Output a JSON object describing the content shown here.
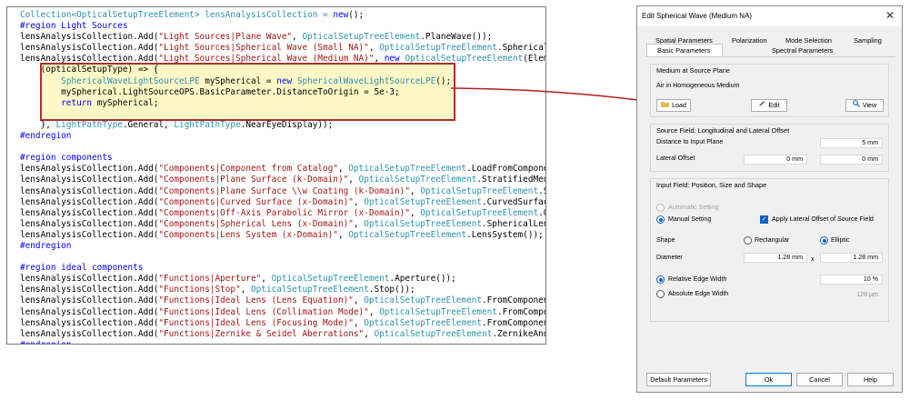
{
  "code": {
    "lines": [
      [
        {
          "t": "Collection<",
          "c": "ty"
        },
        {
          "t": "OpticalSetupTreeElement",
          "c": "ty"
        },
        {
          "t": "> lensAnalysisCollection = ",
          "c": "ty"
        },
        {
          "t": "new",
          "c": "kw"
        },
        {
          "t": "();",
          "c": ""
        }
      ],
      [
        {
          "t": "#region",
          "c": "kw"
        },
        {
          "t": " Light Sources",
          "c": "kw"
        }
      ],
      [
        {
          "t": "lensAnalysisCollection.Add(",
          "c": ""
        },
        {
          "t": "\"Light Sources|Plane Wave\"",
          "c": "st"
        },
        {
          "t": ", ",
          "c": ""
        },
        {
          "t": "OpticalSetupTreeElement",
          "c": "ty"
        },
        {
          "t": ".PlaneWave());",
          "c": ""
        }
      ],
      [
        {
          "t": "lensAnalysisCollection.Add(",
          "c": ""
        },
        {
          "t": "\"Light Sources|Spherical Wave (Small NA)\"",
          "c": "st"
        },
        {
          "t": ", ",
          "c": ""
        },
        {
          "t": "OpticalSetupTreeElement",
          "c": "ty"
        },
        {
          "t": ".SphericalWave",
          "c": ""
        }
      ],
      [
        {
          "t": "lensAnalysisCollection.Add(",
          "c": ""
        },
        {
          "t": "\"Light Sources|Spherical Wave (Medium NA)\"",
          "c": "st"
        },
        {
          "t": ", ",
          "c": ""
        },
        {
          "t": "new",
          "c": "kw"
        },
        {
          "t": " ",
          "c": ""
        },
        {
          "t": "OpticalSetupTreeElement",
          "c": "ty"
        },
        {
          "t": "(Element",
          "c": ""
        }
      ],
      [
        {
          "t": "    (opticalSetupType) => {",
          "c": ""
        }
      ],
      [
        {
          "t": "        ",
          "c": ""
        },
        {
          "t": "SphericalWaveLightSourceLPE",
          "c": "ty"
        },
        {
          "t": " mySpherical = ",
          "c": ""
        },
        {
          "t": "new",
          "c": "kw"
        },
        {
          "t": " ",
          "c": ""
        },
        {
          "t": "SphericalWaveLightSourceLPE",
          "c": "ty"
        },
        {
          "t": "();",
          "c": ""
        }
      ],
      [
        {
          "t": "        mySpherical.LightSourceOPS.BasicParameter.DistanceToOrigin = 5e-3;",
          "c": ""
        }
      ],
      [
        {
          "t": "        ",
          "c": ""
        },
        {
          "t": "return",
          "c": "kw"
        },
        {
          "t": " mySpherical;",
          "c": ""
        }
      ],
      [
        {
          "t": "",
          "c": ""
        }
      ],
      [
        {
          "t": "    }, ",
          "c": ""
        },
        {
          "t": "LightPathType",
          "c": "ty"
        },
        {
          "t": ".General, ",
          "c": ""
        },
        {
          "t": "LightPathType",
          "c": "ty"
        },
        {
          "t": ".NearEyeDisplay));",
          "c": ""
        }
      ],
      [
        {
          "t": "#endregion",
          "c": "kw"
        }
      ],
      [
        {
          "t": "",
          "c": ""
        }
      ],
      [
        {
          "t": "#region",
          "c": "kw"
        },
        {
          "t": " components",
          "c": "kw"
        }
      ],
      [
        {
          "t": "lensAnalysisCollection.Add(",
          "c": ""
        },
        {
          "t": "\"Components|Component from Catalog\"",
          "c": "st"
        },
        {
          "t": ", ",
          "c": ""
        },
        {
          "t": "OpticalSetupTreeElement",
          "c": "ty"
        },
        {
          "t": ".LoadFromComponent(",
          "c": ""
        }
      ],
      [
        {
          "t": "lensAnalysisCollection.Add(",
          "c": ""
        },
        {
          "t": "\"Components|Plane Surface (k-Domain)\"",
          "c": "st"
        },
        {
          "t": ", ",
          "c": ""
        },
        {
          "t": "OpticalSetupTreeElement",
          "c": "ty"
        },
        {
          "t": ".StratifiedMedia(",
          "c": ""
        }
      ],
      [
        {
          "t": "lensAnalysisCollection.Add(",
          "c": ""
        },
        {
          "t": "\"Components|Plane Surface \\\\w Coating (k-Domain)\"",
          "c": "st"
        },
        {
          "t": ", ",
          "c": ""
        },
        {
          "t": "OpticalSetupTreeElement",
          "c": "ty"
        },
        {
          "t": ".Str",
          "c": ""
        }
      ],
      [
        {
          "t": "lensAnalysisCollection.Add(",
          "c": ""
        },
        {
          "t": "\"Components|Curved Surface (x-Domain)\"",
          "c": "st"
        },
        {
          "t": ", ",
          "c": ""
        },
        {
          "t": "OpticalSetupTreeElement",
          "c": "ty"
        },
        {
          "t": ".CurvedSurface(",
          "c": ""
        }
      ],
      [
        {
          "t": "lensAnalysisCollection.Add(",
          "c": ""
        },
        {
          "t": "\"Components|Off-Axis Parabolic Mirror (x-Domain)\"",
          "c": "st"
        },
        {
          "t": ", ",
          "c": ""
        },
        {
          "t": "OpticalSetupTreeElement",
          "c": "ty"
        },
        {
          "t": ".Offa",
          "c": ""
        }
      ],
      [
        {
          "t": "lensAnalysisCollection.Add(",
          "c": ""
        },
        {
          "t": "\"Components|Spherical Lens (x-Domain)\"",
          "c": "st"
        },
        {
          "t": ", ",
          "c": ""
        },
        {
          "t": "OpticalSetupTreeElement",
          "c": "ty"
        },
        {
          "t": ".SphericalLens(",
          "c": ""
        }
      ],
      [
        {
          "t": "lensAnalysisCollection.Add(",
          "c": ""
        },
        {
          "t": "\"Components|Lens System (x-Domain)\"",
          "c": "st"
        },
        {
          "t": ", ",
          "c": ""
        },
        {
          "t": "OpticalSetupTreeElement",
          "c": "ty"
        },
        {
          "t": ".LensSystem());",
          "c": ""
        }
      ],
      [
        {
          "t": "#endregion",
          "c": "kw"
        }
      ],
      [
        {
          "t": "",
          "c": ""
        }
      ],
      [
        {
          "t": "#region",
          "c": "kw"
        },
        {
          "t": " ideal components",
          "c": "kw"
        }
      ],
      [
        {
          "t": "lensAnalysisCollection.Add(",
          "c": ""
        },
        {
          "t": "\"Functions|Aperture\"",
          "c": "st"
        },
        {
          "t": ", ",
          "c": ""
        },
        {
          "t": "OpticalSetupTreeElement",
          "c": "ty"
        },
        {
          "t": ".Aperture());",
          "c": ""
        }
      ],
      [
        {
          "t": "lensAnalysisCollection.Add(",
          "c": ""
        },
        {
          "t": "\"Functions|Stop\"",
          "c": "st"
        },
        {
          "t": ", ",
          "c": ""
        },
        {
          "t": "OpticalSetupTreeElement",
          "c": "ty"
        },
        {
          "t": ".Stop());",
          "c": ""
        }
      ],
      [
        {
          "t": "lensAnalysisCollection.Add(",
          "c": ""
        },
        {
          "t": "\"Functions|Ideal Lens (Lens Equation)\"",
          "c": "st"
        },
        {
          "t": ", ",
          "c": ""
        },
        {
          "t": "OpticalSetupTreeElement",
          "c": "ty"
        },
        {
          "t": ".FromComponentCa",
          "c": ""
        }
      ],
      [
        {
          "t": "lensAnalysisCollection.Add(",
          "c": ""
        },
        {
          "t": "\"Functions|Ideal Lens (Collimation Mode)\"",
          "c": "st"
        },
        {
          "t": ", ",
          "c": ""
        },
        {
          "t": "OpticalSetupTreeElement",
          "c": "ty"
        },
        {
          "t": ".FromComponen",
          "c": ""
        }
      ],
      [
        {
          "t": "lensAnalysisCollection.Add(",
          "c": ""
        },
        {
          "t": "\"Functions|Ideal Lens (Focusing Mode)\"",
          "c": "st"
        },
        {
          "t": ", ",
          "c": ""
        },
        {
          "t": "OpticalSetupTreeElement",
          "c": "ty"
        },
        {
          "t": ".FromComponentCa",
          "c": ""
        }
      ],
      [
        {
          "t": "lensAnalysisCollection.Add(",
          "c": ""
        },
        {
          "t": "\"Functions|Zernike & Seidel Aberrations\"",
          "c": "st"
        },
        {
          "t": ", ",
          "c": ""
        },
        {
          "t": "OpticalSetupTreeElement",
          "c": "ty"
        },
        {
          "t": ".ZernikeAndSe",
          "c": ""
        }
      ],
      [
        {
          "t": "#endregion",
          "c": "kw"
        }
      ]
    ]
  },
  "dialog": {
    "title": "Edit Spherical Wave (Medium NA)",
    "tabs_row1": [
      "Spatial Parameters",
      "Polarization",
      "Mode Selection",
      "Sampling"
    ],
    "tabs_row2": [
      "Basic Parameters",
      "Spectral Parameters"
    ],
    "active_tab": "Basic Parameters",
    "medium": {
      "title": "Medium at Source Plane",
      "value": "Air in Homogeneous Medium",
      "load": "Load",
      "edit": "Edit",
      "view": "View"
    },
    "source": {
      "title": "Source Field: Longitudinal and Lateral Offset",
      "distance_label": "Distance to Input Plane",
      "distance_value": "5 mm",
      "lateral_label": "Lateral Offset",
      "lateral_x": "0 mm",
      "lateral_y": "0 mm"
    },
    "input": {
      "title": "Input Field: Position, Size and Shape",
      "automatic": "Automatic Setting",
      "manual": "Manual Setting",
      "apply_offset": "Apply Lateral Offset of Source Field",
      "shape_label": "Shape",
      "rectangular": "Rectangular",
      "elliptic": "Elliptic",
      "diameter_label": "Diameter",
      "diameter_x": "1.28 mm",
      "times": "x",
      "diameter_y": "1.28 mm",
      "relative": "Relative Edge Width",
      "relative_value": "10 %",
      "absolute": "Absolute Edge Width",
      "absolute_value": "128 µm"
    },
    "footer": {
      "default": "Default Parameters",
      "ok": "Ok",
      "cancel": "Cancel",
      "help": "Help"
    }
  },
  "colors": {
    "keyword": "#0000ff",
    "type": "#2b91af",
    "string": "#a31515",
    "highlight_fill": "#fff8c6",
    "highlight_border": "#a9322d",
    "accent": "#1060c8"
  }
}
